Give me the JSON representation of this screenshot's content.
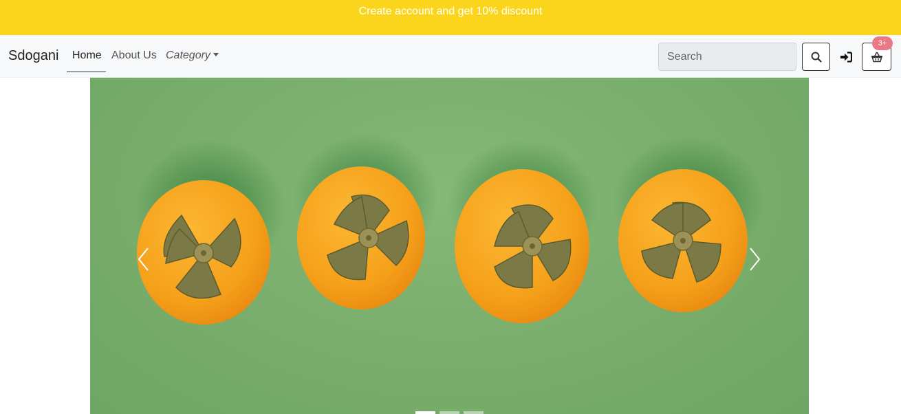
{
  "promo": {
    "text": "Create account and get 10% discount"
  },
  "nav": {
    "brand": "Sdogani",
    "home": "Home",
    "about": "About Us",
    "category": "Category"
  },
  "search": {
    "placeholder": "Search"
  },
  "cart": {
    "badge": "3+"
  },
  "carousel": {
    "slide_count": 3,
    "active_index": 0,
    "icons": {
      "prev": "chevron-left-icon",
      "next": "chevron-right-icon"
    }
  },
  "colors": {
    "promo_bg": "#fbd51c",
    "navbar_bg": "#f7f8fa",
    "badge_bg": "#e97987",
    "slide_bg": "#7aae6c",
    "fruit": "#f5a21b"
  }
}
